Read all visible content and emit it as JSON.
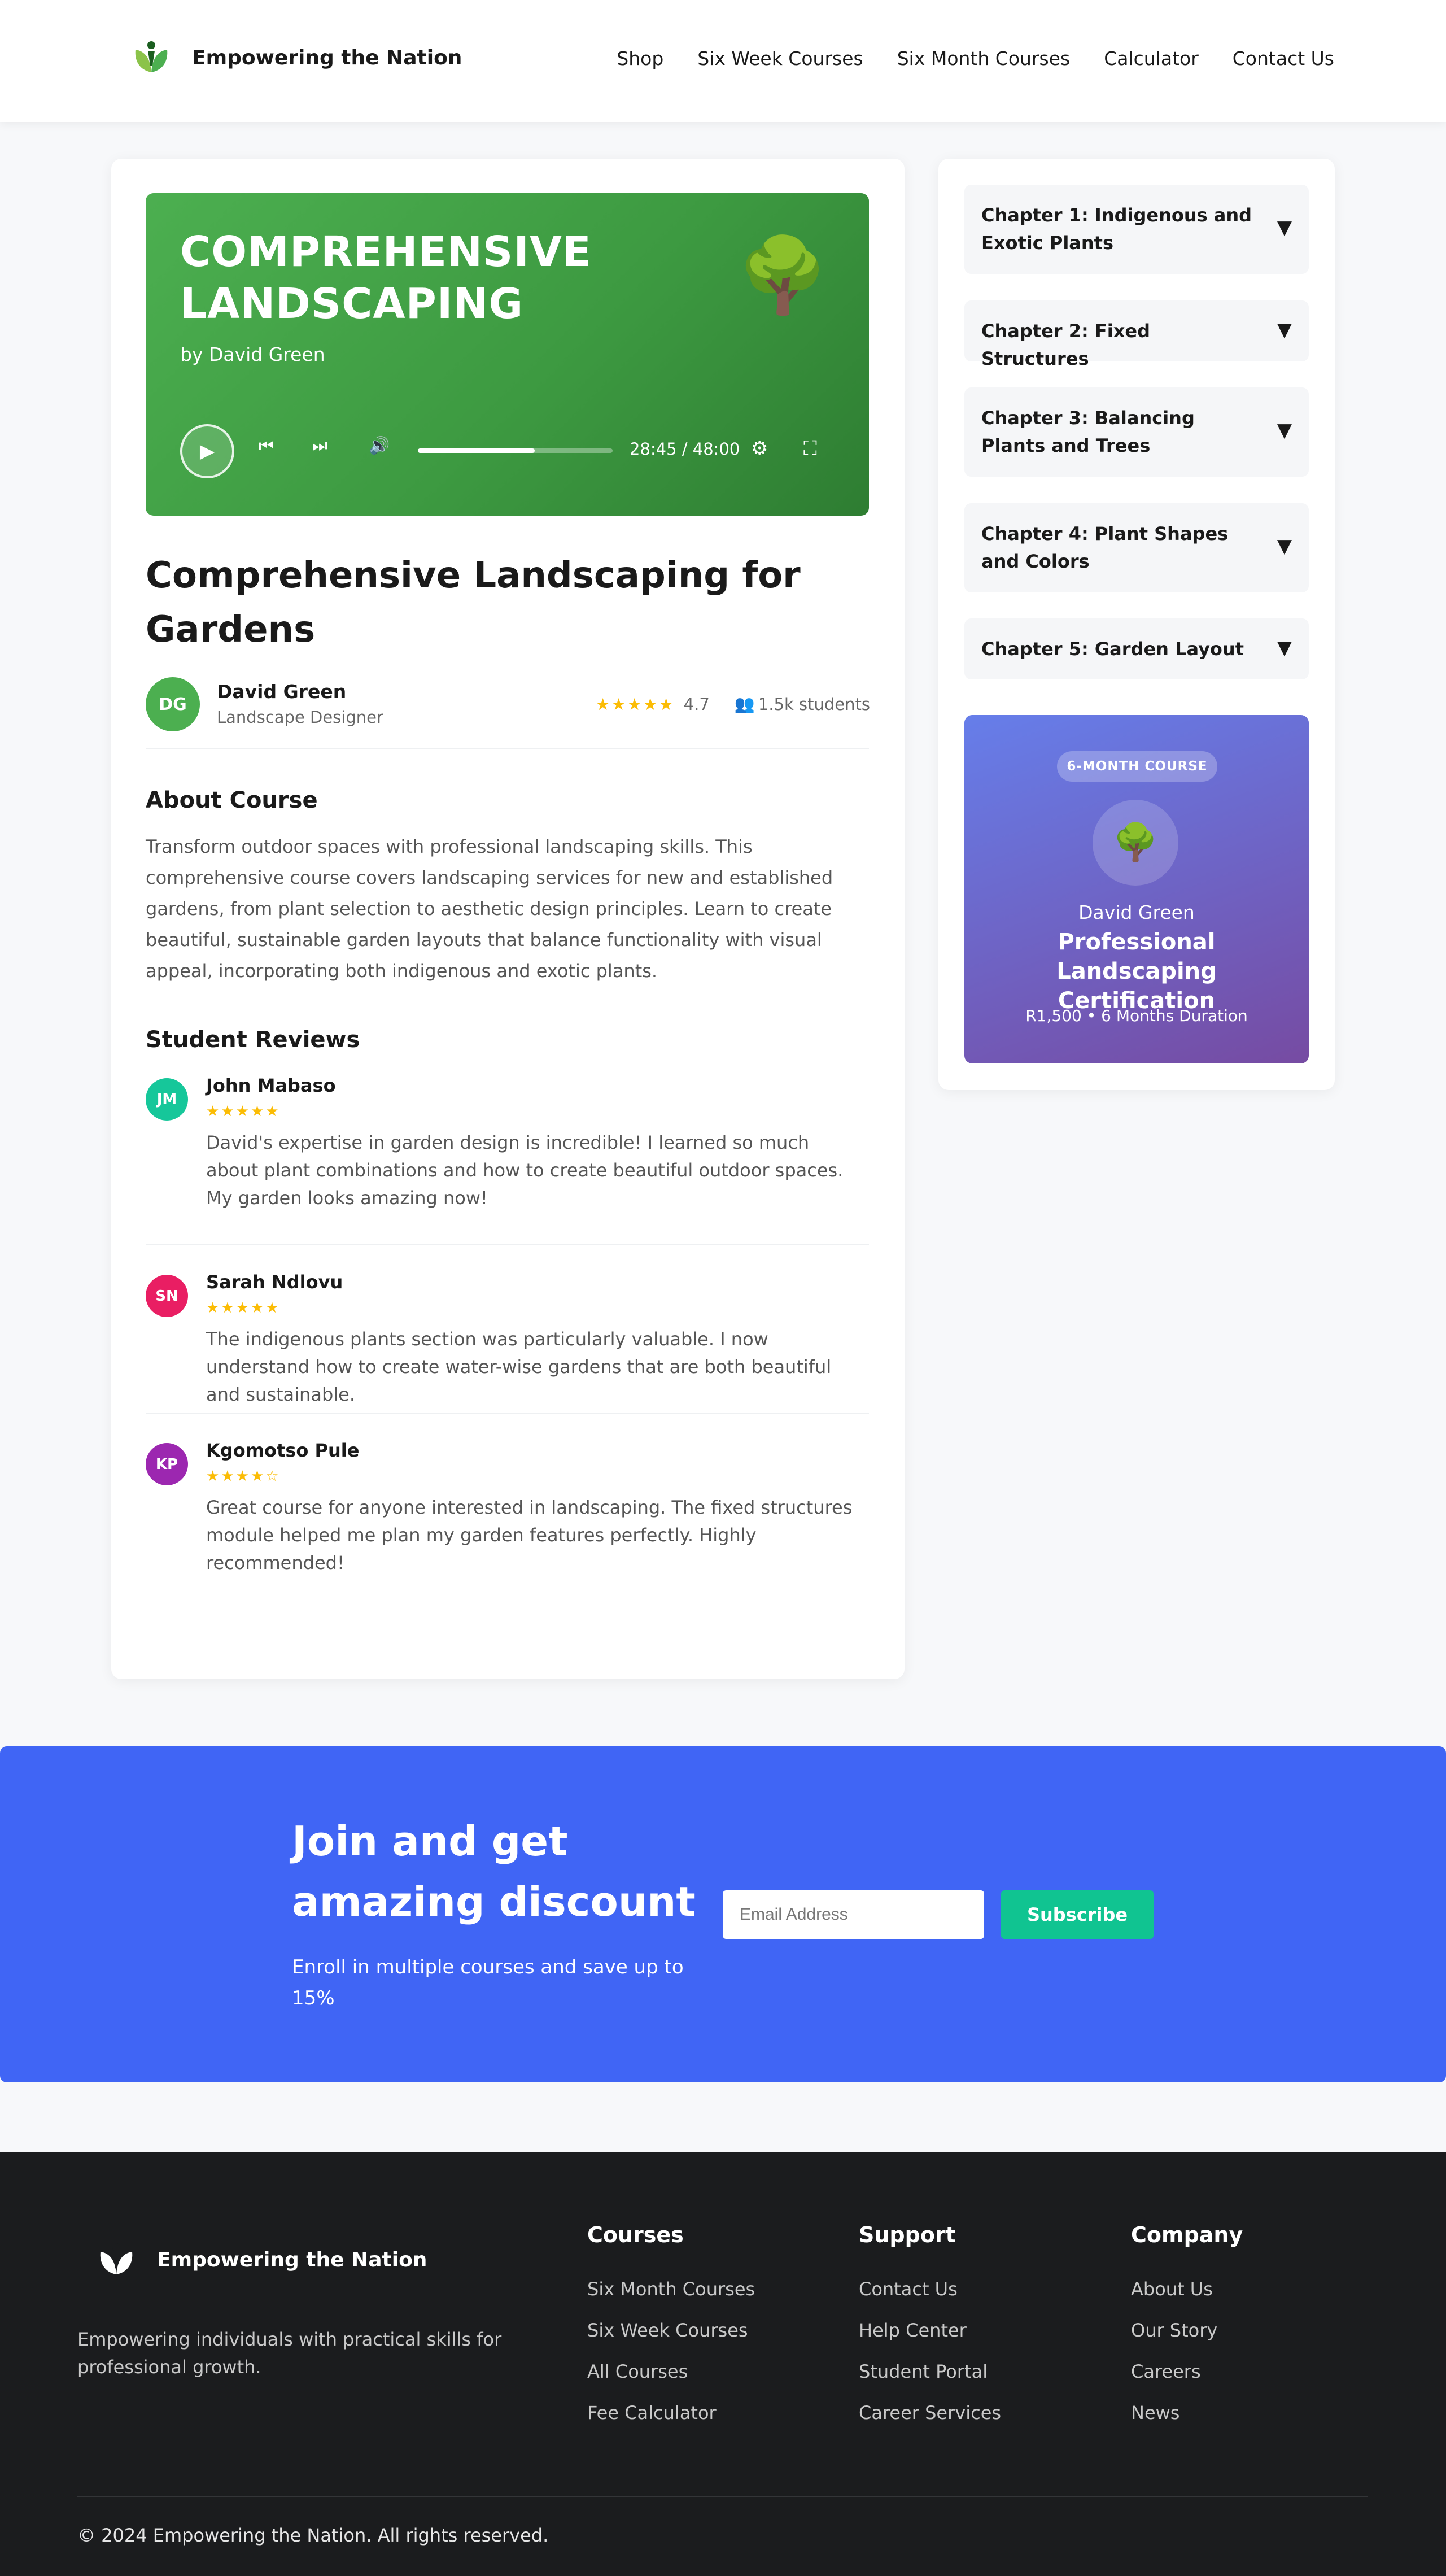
{
  "header": {
    "brand": "Empowering the Nation",
    "nav": [
      "Shop",
      "Six Week Courses",
      "Six Month Courses",
      "Calculator",
      "Contact Us"
    ]
  },
  "player": {
    "title": "COMPREHENSIVE LANDSCAPING",
    "author": "by David Green",
    "emoji": "🌳",
    "time": "28:45 / 48:00",
    "progress_fraction": 0.6
  },
  "course": {
    "title": "Comprehensive Landscaping for Gardens",
    "instructor_initials": "DG",
    "instructor_name": "David Green",
    "instructor_role": "Landscape Designer",
    "stars": "★★★★★",
    "rating": "4.7",
    "students": "1.5k students",
    "about_heading": "About Course",
    "about_text": "Transform outdoor spaces with professional landscaping skills. This comprehensive course covers landscaping services for new and established gardens, from plant selection to aesthetic design principles. Learn to create beautiful, sustainable garden layouts that balance functionality with visual appeal, incorporating both indigenous and exotic plants.",
    "reviews_heading": "Student Reviews"
  },
  "reviews": [
    {
      "initials": "JM",
      "name": "John Mabaso",
      "stars": "★★★★★",
      "text": "David's expertise in garden design is incredible! I learned so much about plant combinations and how to create beautiful outdoor spaces. My garden looks amazing now!",
      "color": "#16c79a"
    },
    {
      "initials": "SN",
      "name": "Sarah Ndlovu",
      "stars": "★★★★★",
      "text": "The indigenous plants section was particularly valuable. I now understand how to create water-wise gardens that are both beautiful and sustainable.",
      "color": "#e91e63"
    },
    {
      "initials": "KP",
      "name": "Kgomotso Pule",
      "stars": "★★★★☆",
      "text": "Great course for anyone interested in landscaping. The fixed structures module helped me plan my garden features perfectly. Highly recommended!",
      "color": "#9c27b0"
    }
  ],
  "chapters": [
    "Chapter 1: Indigenous and Exotic Plants",
    "Chapter 2: Fixed Structures",
    "Chapter 3: Balancing Plants and Trees",
    "Chapter 4: Plant Shapes and Colors",
    "Chapter 5: Garden Layout"
  ],
  "promo": {
    "badge": "6-MONTH COURSE",
    "emoji": "🌳",
    "author": "David Green",
    "title": "Professional Landscaping Certification",
    "meta": "R1,500 • 6 Months Duration"
  },
  "newsletter": {
    "title": "Join and get amazing discount",
    "subtitle": "Enroll in multiple courses and save up to 15%",
    "placeholder": "Email Address",
    "button": "Subscribe"
  },
  "footer": {
    "brand": "Empowering the Nation",
    "description": "Empowering individuals with practical skills for professional growth.",
    "columns": [
      {
        "title": "Courses",
        "links": [
          "Six Month Courses",
          "Six Week Courses",
          "All Courses",
          "Fee Calculator"
        ]
      },
      {
        "title": "Support",
        "links": [
          "Contact Us",
          "Help Center",
          "Student Portal",
          "Career Services"
        ]
      },
      {
        "title": "Company",
        "links": [
          "About Us",
          "Our Story",
          "Careers",
          "News"
        ]
      }
    ],
    "copyright": "© 2024 Empowering the Nation. All rights reserved."
  },
  "colors": {
    "accent_green": "#4caf50",
    "newsletter_blue": "#4065f5",
    "subscribe_green": "#10c491",
    "star": "#fbbc04",
    "footer_bg": "#1b1c1e"
  }
}
